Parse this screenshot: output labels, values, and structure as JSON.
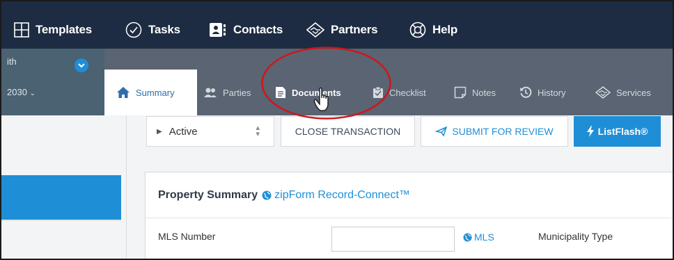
{
  "topnav": {
    "items": [
      {
        "label": "Templates",
        "icon": "templates-icon"
      },
      {
        "label": "Tasks",
        "icon": "check-circle-icon"
      },
      {
        "label": "Contacts",
        "icon": "contacts-card-icon"
      },
      {
        "label": "Partners",
        "icon": "handshake-diamond-icon"
      },
      {
        "label": "Help",
        "icon": "lifebuoy-icon"
      }
    ]
  },
  "agent": {
    "name_fragment": "ith",
    "year_fragment": "2030"
  },
  "tabs": [
    {
      "label": "Summary",
      "icon": "home-icon",
      "state": "active"
    },
    {
      "label": "Parties",
      "icon": "users-icon"
    },
    {
      "label": "Documents",
      "icon": "document-icon",
      "state": "hover"
    },
    {
      "label": "Checklist",
      "icon": "clipboard-check-icon"
    },
    {
      "label": "Notes",
      "icon": "note-icon"
    },
    {
      "label": "History",
      "icon": "history-icon"
    },
    {
      "label": "Services",
      "icon": "handshake-diamond-icon"
    }
  ],
  "actions": {
    "status_value": "Active",
    "close_label": "CLOSE TRANSACTION",
    "submit_label": "SUBMIT FOR REVIEW",
    "listflash_label": "ListFlash®"
  },
  "property_summary": {
    "title": "Property Summary",
    "link_label": "zipForm Record-Connect™",
    "mls_label": "MLS Number",
    "mls_value": "",
    "mls_link": "MLS",
    "municipality_label": "Municipality Type"
  },
  "colors": {
    "nav_bg": "#1d2c42",
    "tab_bg": "#5a6472",
    "accent": "#1e8fd6",
    "annotation": "#d0151b"
  }
}
